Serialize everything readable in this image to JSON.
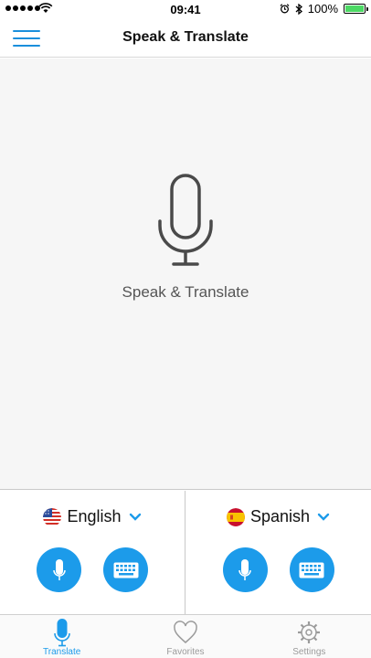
{
  "status_bar": {
    "time": "09:41",
    "battery": "100%",
    "battery_level": 1.0
  },
  "nav": {
    "title": "Speak & Translate"
  },
  "main": {
    "label": "Speak & Translate"
  },
  "languages": {
    "source": {
      "name": "English",
      "flag": "us-flag"
    },
    "target": {
      "name": "Spanish",
      "flag": "es-flag"
    }
  },
  "tabs": [
    {
      "label": "Translate",
      "icon": "mic-icon",
      "active": true
    },
    {
      "label": "Favorites",
      "icon": "heart-icon",
      "active": false
    },
    {
      "label": "Settings",
      "icon": "gear-icon",
      "active": false
    }
  ],
  "colors": {
    "accent": "#1c9bea",
    "background": "#f6f6f6",
    "tab_inactive": "#9b9b9b"
  }
}
